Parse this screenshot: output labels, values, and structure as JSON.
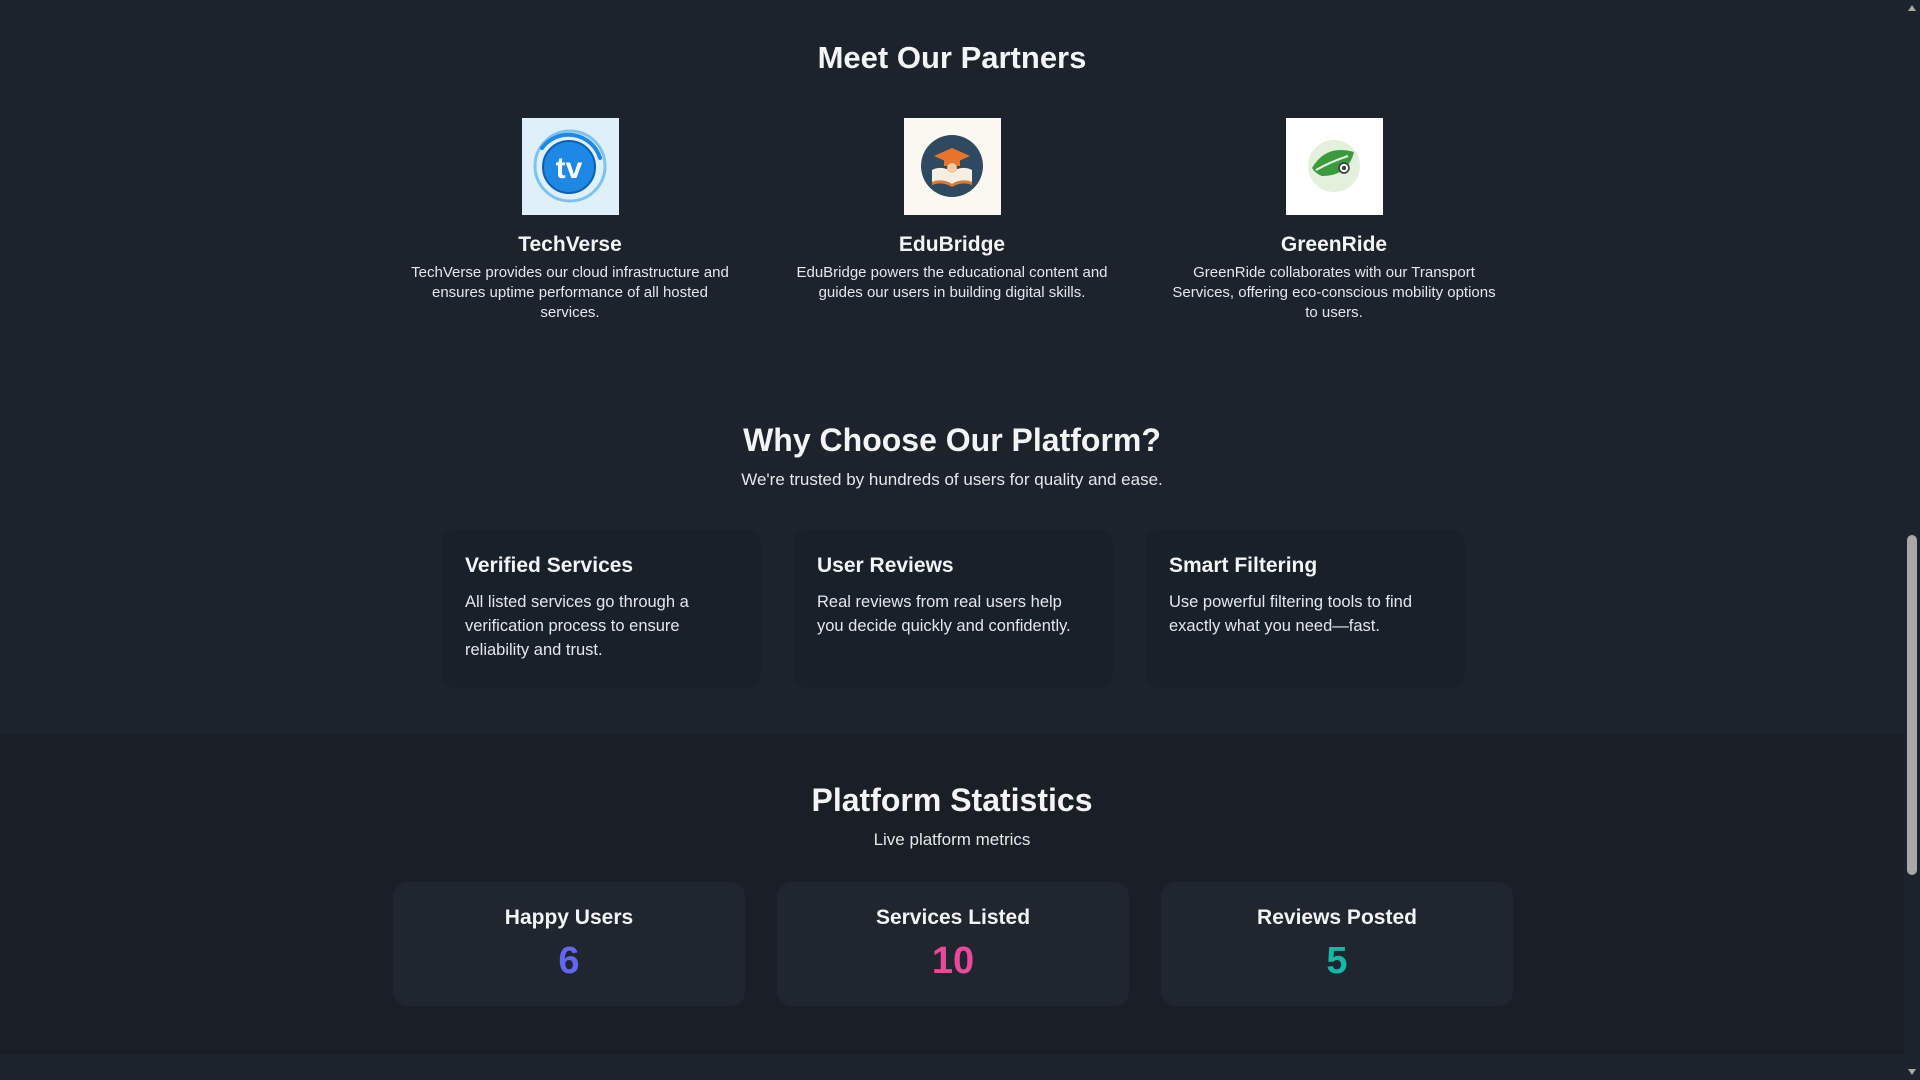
{
  "partners": {
    "title": "Meet Our Partners",
    "items": [
      {
        "name": "TechVerse",
        "logo_icon": "tv-logo-icon",
        "description": "TechVerse provides our cloud infrastructure and ensures uptime performance of all hosted services."
      },
      {
        "name": "EduBridge",
        "logo_icon": "graduation-book-logo-icon",
        "description": "EduBridge powers the educational content and guides our users in building digital skills."
      },
      {
        "name": "GreenRide",
        "logo_icon": "leaf-logo-icon",
        "description": "GreenRide collaborates with our Transport Services, offering eco-conscious mobility options to users."
      }
    ]
  },
  "why": {
    "title": "Why Choose Our Platform?",
    "subtitle": "We're trusted by hundreds of users for quality and ease.",
    "features": [
      {
        "title": "Verified Services",
        "description": "All listed services go through a verification process to ensure reliability and trust."
      },
      {
        "title": "User Reviews",
        "description": "Real reviews from real users help you decide quickly and confidently."
      },
      {
        "title": "Smart Filtering",
        "description": "Use powerful filtering tools to find exactly what you need—fast."
      }
    ]
  },
  "stats": {
    "title": "Platform Statistics",
    "subtitle": "Live platform metrics",
    "items": [
      {
        "label": "Happy Users",
        "value": "6",
        "color": "#6366f1"
      },
      {
        "label": "Services Listed",
        "value": "10",
        "color": "#ec4899"
      },
      {
        "label": "Reviews Posted",
        "value": "5",
        "color": "#14b8a6"
      }
    ]
  },
  "colors": {
    "background": "#1c232c",
    "stats_background": "#1a1e25",
    "card_background": "#1f2630"
  }
}
